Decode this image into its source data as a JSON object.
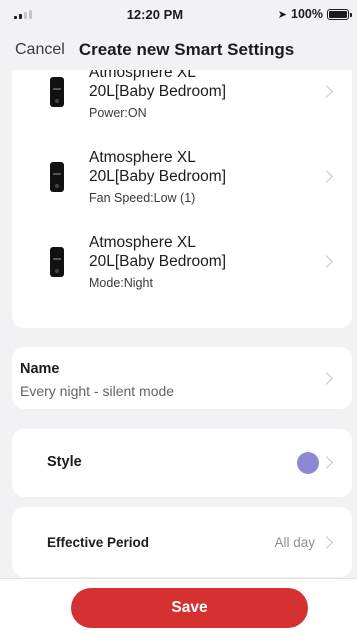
{
  "status_bar": {
    "time": "12:20 PM",
    "location_icon": "location-arrow-icon",
    "battery": "100%"
  },
  "nav": {
    "cancel_label": "Cancel",
    "title": "Create new Smart Settings"
  },
  "devices": [
    {
      "name_line1": "Atmosphere XL",
      "name_line2": "20L[Baby Bedroom]",
      "status": "Power:ON"
    },
    {
      "name_line1": "Atmosphere XL",
      "name_line2": "20L[Baby Bedroom]",
      "status": "Fan Speed:Low (1)"
    },
    {
      "name_line1": "Atmosphere XL",
      "name_line2": "20L[Baby Bedroom]",
      "status": "Mode:Night"
    }
  ],
  "name_setting": {
    "label": "Name",
    "value": "Every night - silent mode"
  },
  "style_setting": {
    "label": "Style",
    "color": "#8e88d4"
  },
  "period_setting": {
    "label": "Effective Period",
    "value": "All day"
  },
  "footer": {
    "save_label": "Save"
  },
  "colors": {
    "accent": "#d63131",
    "background": "#f2f2f4"
  }
}
